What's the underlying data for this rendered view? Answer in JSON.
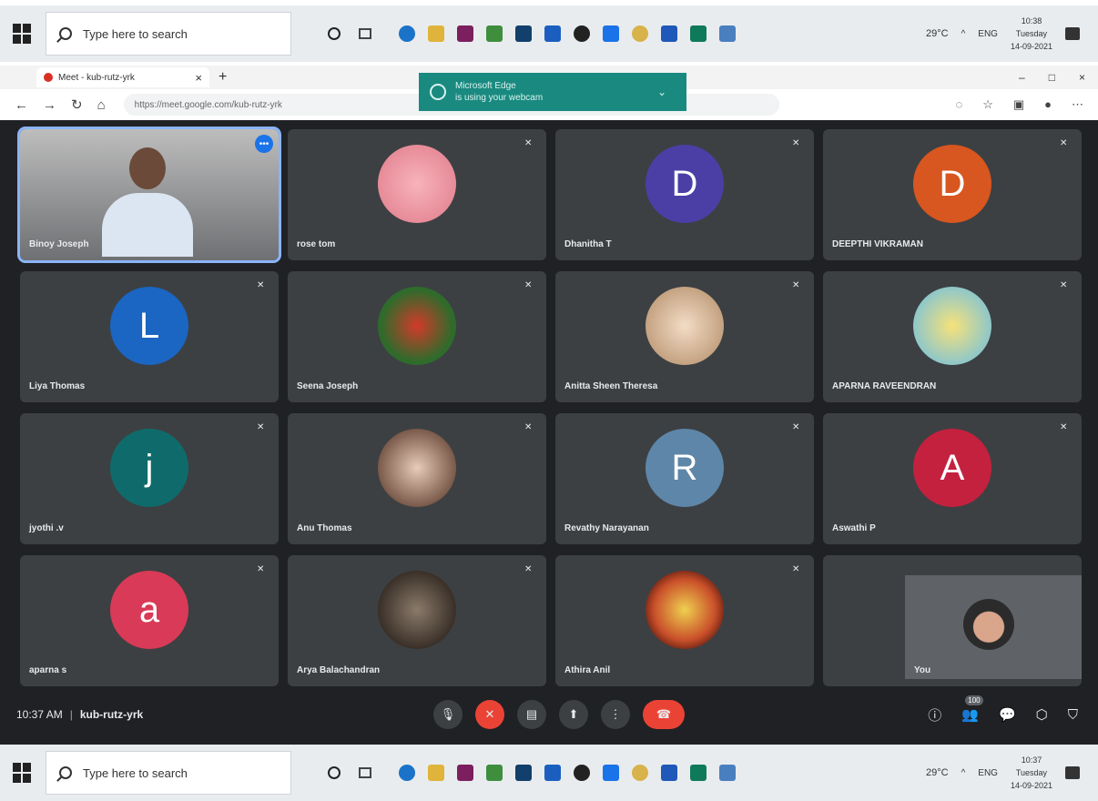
{
  "taskbar_top": {
    "search_placeholder": "Type here to search",
    "temperature": "29°C",
    "lang": "ENG",
    "time": "10:38",
    "day": "Tuesday",
    "date": "14-09-2021"
  },
  "taskbar_bottom": {
    "search_placeholder": "Type here to search",
    "temperature": "29°C",
    "lang": "ENG",
    "time": "10:37",
    "day": "Tuesday",
    "date": "14-09-2021"
  },
  "browser": {
    "tab_title": "Meet - kub-rutz-yrk",
    "url": "https://meet.google.com/kub-rutz-yrk",
    "toast_title": "Microsoft Edge",
    "toast_body": "is using your webcam"
  },
  "participants": [
    {
      "name": "Binoy Joseph",
      "initial": "",
      "color": ""
    },
    {
      "name": "rose tom",
      "initial": "",
      "color": "#f0a0a8"
    },
    {
      "name": "Dhanitha T",
      "initial": "D",
      "color": "#4b3fa6"
    },
    {
      "name": "DEEPTHI VIKRAMAN",
      "initial": "D",
      "color": "#d8561f"
    },
    {
      "name": "Liya Thomas",
      "initial": "L",
      "color": "#1a66c2"
    },
    {
      "name": "Seena Joseph",
      "initial": "",
      "color": "#2f6b2b"
    },
    {
      "name": "Anitta Sheen Theresa",
      "initial": "",
      "color": "#c9a27a"
    },
    {
      "name": "APARNA RAVEENDRAN",
      "initial": "",
      "color": "#e8d79a"
    },
    {
      "name": "jyothi .v",
      "initial": "j",
      "color": "#0f6b6b"
    },
    {
      "name": "Anu Thomas",
      "initial": "",
      "color": "#d8b7a5"
    },
    {
      "name": "Revathy Narayanan",
      "initial": "R",
      "color": "#5e86a8"
    },
    {
      "name": "Aswathi P",
      "initial": "A",
      "color": "#c4213f"
    },
    {
      "name": "aparna s",
      "initial": "a",
      "color": "#d93a57"
    },
    {
      "name": "Arya Balachandran",
      "initial": "",
      "color": "#6a5a4c"
    },
    {
      "name": "Athira Anil",
      "initial": "",
      "color": "#c9502a"
    },
    {
      "name": "You",
      "initial": "",
      "color": ""
    }
  ],
  "meeting": {
    "time": "10:37 AM",
    "code": "kub-rutz-yrk",
    "people_count": "100"
  }
}
